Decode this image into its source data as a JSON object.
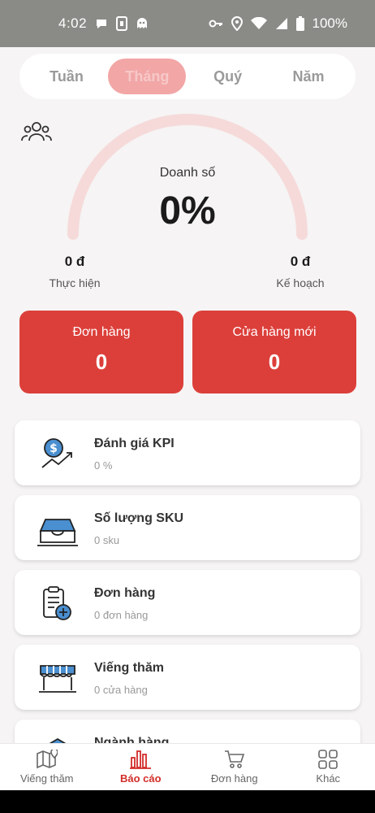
{
  "status": {
    "time": "4:02",
    "battery": "100%"
  },
  "tabs": [
    {
      "label": "Tuần"
    },
    {
      "label": "Tháng"
    },
    {
      "label": "Quý"
    },
    {
      "label": "Năm"
    }
  ],
  "gauge": {
    "label": "Doanh số",
    "value": "0%",
    "progress": 0,
    "actual_value": "0 đ",
    "actual_label": "Thực hiện",
    "plan_value": "0 đ",
    "plan_label": "Kế hoạch"
  },
  "cards": [
    {
      "title": "Đơn hàng",
      "value": "0"
    },
    {
      "title": "Cửa hàng mới",
      "value": "0"
    }
  ],
  "list": [
    {
      "title": "Đánh giá KPI",
      "sub": "0 %",
      "icon": "kpi-dollar-icon"
    },
    {
      "title": "Số lượng SKU",
      "sub": "0 sku",
      "icon": "inbox-tray-icon"
    },
    {
      "title": "Đơn hàng",
      "sub": "0 đơn hàng",
      "icon": "clipboard-add-icon"
    },
    {
      "title": "Viếng thăm",
      "sub": "0 cửa hàng",
      "icon": "store-awning-icon"
    },
    {
      "title": "Ngành hàng",
      "icon": "category-icon"
    }
  ],
  "nav": [
    {
      "label": "Viếng thăm",
      "icon": "map-pin-icon"
    },
    {
      "label": "Báo cáo",
      "icon": "bar-chart-icon"
    },
    {
      "label": "Đơn hàng",
      "icon": "cart-icon"
    },
    {
      "label": "Khác",
      "icon": "grid-icon"
    }
  ],
  "colors": {
    "accent": "#dc3f3a",
    "tab_active": "#f2a6a6",
    "gauge_track": "#f6dada",
    "icon_blue": "#3a78b8"
  }
}
